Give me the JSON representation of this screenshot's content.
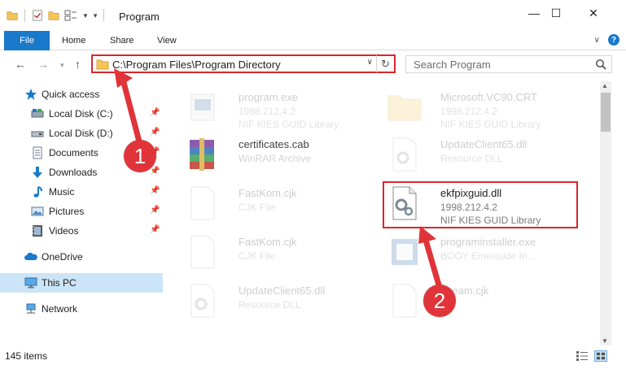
{
  "window": {
    "title": "Program",
    "minimize": "—",
    "maximize": "☐",
    "close": "✕"
  },
  "ribbon": {
    "file": "File",
    "home": "Home",
    "share": "Share",
    "view": "View",
    "help": "?"
  },
  "address": {
    "path": "C:\\Program Files\\Program Directory",
    "search_placeholder": "Search Program"
  },
  "sidebar": {
    "quick_access": "Quick access",
    "items": [
      {
        "label": "Local Disk (C:)",
        "icon": "drive-icon",
        "pinned": true
      },
      {
        "label": "Local Disk (D:)",
        "icon": "drive-icon",
        "pinned": true
      },
      {
        "label": "Documents",
        "icon": "documents-icon",
        "pinned": true
      },
      {
        "label": "Downloads",
        "icon": "downloads-icon",
        "pinned": true
      },
      {
        "label": "Music",
        "icon": "music-icon",
        "pinned": true
      },
      {
        "label": "Pictures",
        "icon": "pictures-icon",
        "pinned": true
      },
      {
        "label": "Videos",
        "icon": "videos-icon",
        "pinned": true
      }
    ],
    "onedrive": "OneDrive",
    "this_pc": "This PC",
    "network": "Network"
  },
  "files": [
    {
      "name": "program.exe",
      "line1": "1998.212.4.2",
      "line2": "NIF KIES GUID Library",
      "faded": true
    },
    {
      "name": "Microsoft.VC90.CRT",
      "line1": "1998.212.4.2",
      "line2": "NIF KIES GUID Library",
      "faded": true
    },
    {
      "name": "certificates.cab",
      "line1": "WinRAR Archive",
      "line2": "",
      "faded": true
    },
    {
      "name": "UpdateClient65.dll",
      "line1": "Resource DLL",
      "line2": "",
      "faded": true
    },
    {
      "name": "FastKom.cjk",
      "line1": "CJK File",
      "line2": "",
      "faded": true
    },
    {
      "name": "ekfpixguid.dll",
      "line1": "1998.212.4.2",
      "line2": "NIF KIES GUID Library",
      "faded": false
    },
    {
      "name": "FastKom.cjk",
      "line1": "CJK File",
      "line2": "",
      "faded": true
    },
    {
      "name": "programinstaller.exe",
      "line1": "BOOY Emeraude In...",
      "line2": "",
      "faded": true
    },
    {
      "name": "UpdateClient65.dll",
      "line1": "Resource DLL",
      "line2": "",
      "faded": true
    },
    {
      "name": "stream.cjk",
      "line1": "",
      "line2": "",
      "faded": true
    }
  ],
  "status": {
    "items_count": "145 items"
  },
  "callouts": {
    "one": "1",
    "two": "2"
  },
  "colors": {
    "accent": "#1979ca",
    "highlight_red": "#d9262a",
    "selected_bg": "#cce4f7"
  }
}
